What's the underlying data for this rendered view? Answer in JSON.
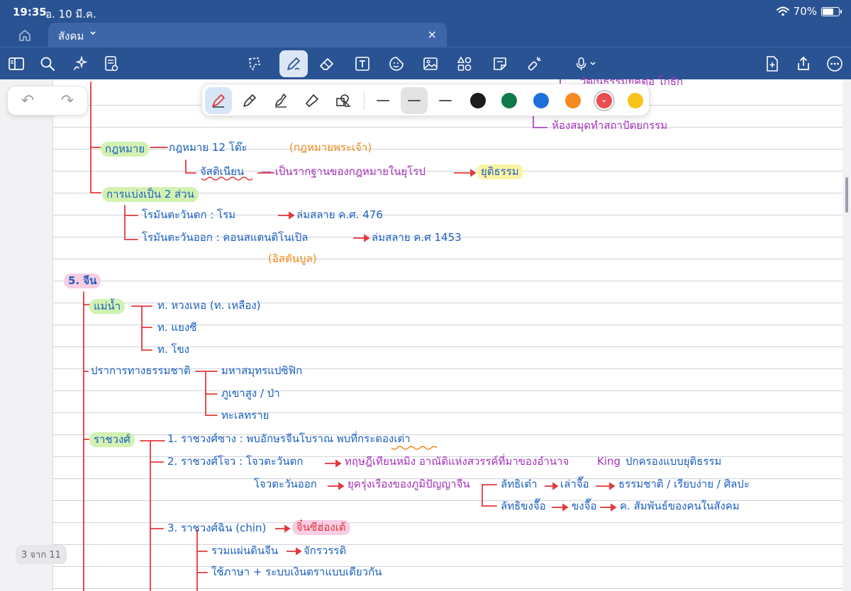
{
  "status": {
    "time": "19:35",
    "date": "อ. 10 มี.ค.",
    "battery_text": "70%",
    "battery_level": 0.7
  },
  "tabs": {
    "home_icon": "home-icon",
    "active_title": "สังคม",
    "close": "×"
  },
  "toolbar": {
    "left": [
      "sidebar-icon",
      "search-icon",
      "sparkle-icon",
      "document-settings-icon"
    ],
    "center": [
      "lasso-icon",
      "pen-icon",
      "eraser-icon",
      "text-box-icon",
      "sticker-icon",
      "image-icon",
      "shapes-icon",
      "sticky-note-icon",
      "laser-pointer-icon"
    ],
    "mic": "microphone-icon",
    "right": [
      "add-page-icon",
      "share-icon",
      "more-icon"
    ]
  },
  "palette": {
    "tools": [
      "fountain-pen",
      "ballpoint-pen",
      "brush-pen",
      "highlighter",
      "shape-tool"
    ],
    "widths": [
      "thin",
      "medium",
      "thick"
    ],
    "active_width": "medium",
    "colors": [
      "#1c1c1e",
      "#0e7a4a",
      "#1e6fd9",
      "#f58a1f",
      "#ea4d4f",
      "#f7c21a"
    ],
    "selected_color": "#ea4d4f"
  },
  "undo_redo": {
    "undo": "↶",
    "redo": "↷"
  },
  "page_indicator": "3 จาก 11",
  "notes": {
    "top_fragment": "วัฒนธรรมยุคต่อ โกธิก",
    "top_fragment2": "ห้องสมุดทำสถาปัตยกรรม",
    "law": "กฎหมาย",
    "law_desc": "กฎหมาย   12 โต๊ะ",
    "law_paren": "(กฎหมายพระเจ้า)",
    "justinian": "จัสติเนียน",
    "justinian_desc": "— เป็นรากฐานของกฎหมายในยุโรป",
    "justinian_result": "ยุติธรรม",
    "split": "การแบ่งเป็น  2 ส่วน",
    "west_rome": "โรมันตะวันตก  :  โรม",
    "west_fall": "ล่มสลาย ค.ศ. 476",
    "east_rome": "โรมันตะวันออก  :  คอนสแตนติโนเปิล",
    "east_fall": "ล่มสลาย ค.ศ 1453",
    "istanbul": "(อิสตันบูล)",
    "china": "5. จีน",
    "rivers": "แม่น้ำ",
    "river1": "ท. หวงเหอ  (ท. เหลือง)",
    "river2": "ท. แยงซี",
    "river3": "ท. โขง",
    "natural": "ปราการทางธรรมชาติ",
    "natural1": "มหาสมุทรแปซิฟิก",
    "natural2": "ภูเขาสูง / ป่า",
    "natural3": "ทะเลทราย",
    "dynasty": "ราชวงศ์",
    "shang": "1. ราชวงศ์ซาง  :  พบอักษรจีนโบราณ  พบที่กระดองเต่า",
    "zhou": "2. ราชวงศ์โจว  :  โจวตะวันตก",
    "zhou_desc": "ทฤษฎีเทียนหมิง  อาณัติแห่งสวรรค์ที่มาของอำนาจ",
    "king": "King",
    "zhou_desc2": "ปกครองแบบยุติธรรม",
    "east_zhou": "โจวตะวันออก",
    "east_zhou_desc": "ยุครุ่งเรืองของภูมิปัญญาจีน",
    "taoism": "ลัทธิเต๋า",
    "laozi": "เล่าจื๊อ",
    "taoism_desc": "ธรรมชาติ / เรียบง่าย / ศิลปะ",
    "confucius": "ลัทธิขงจื๊อ",
    "kongzi": "ขงจื๊อ",
    "confucius_desc": "ค. สัมพันธ์ของคนในสังคม",
    "qin": "3. ราชวงศ์ฉิน  (chin)",
    "qin_emperor": "จิ๋นซีฮ่องเต้",
    "qin1": "รวมแผ่นดินจีน",
    "qin1_result": "จักรวรรดิ",
    "qin2": "ใช้ภาษา + ระบบเงินตราแบบเดียวกัน"
  }
}
